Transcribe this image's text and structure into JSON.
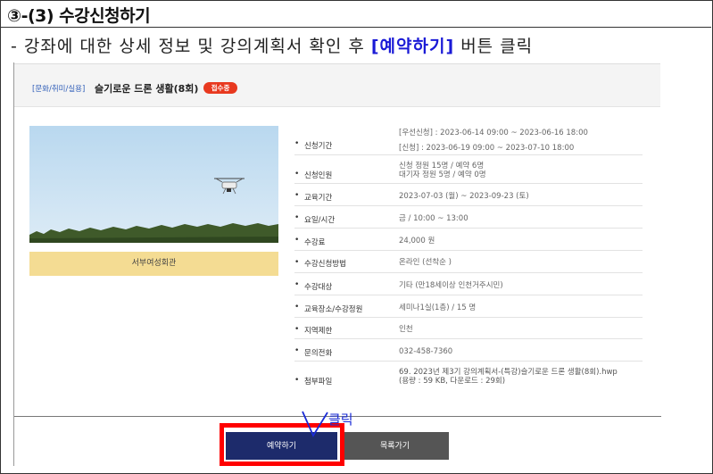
{
  "doc": {
    "step_title": "③-(3) 수강신청하기",
    "instruction_prefix": "- 강좌에 대한 상세 정보 및 강의계획서 확인 후 ",
    "instruction_highlight": "[예약하기]",
    "instruction_suffix": " 버튼 클릭",
    "click_note": "클릭"
  },
  "course": {
    "category": "[문화/취미/실용]",
    "name": "슬기로운 드론 생활(8회)",
    "status_badge": "접수중",
    "location": "서부여성회관"
  },
  "info": [
    {
      "label": "신청기간",
      "value": "[우선신청] : 2023-06-14 09:00 ~ 2023-06-16 18:00\n[신청] : 2023-06-19 09:00 ~ 2023-07-10 18:00"
    },
    {
      "label": "신청인원",
      "value": "신청 정원 15명 / 예약 6명\n대기자 정원 5명 / 예약 0명"
    },
    {
      "label": "교육기간",
      "value": "2023-07-03 (월) ~ 2023-09-23 (토)"
    },
    {
      "label": "요일/시간",
      "value": "금 / 10:00 ~ 13:00"
    },
    {
      "label": "수강료",
      "value": "24,000 원"
    },
    {
      "label": "수강신청방법",
      "value": "온라인 (선착순 )"
    },
    {
      "label": "수강대상",
      "value": "기타 (만18세이상 인천거주시민)"
    },
    {
      "label": "교육장소/수강정원",
      "value": "세미나1실(1층) / 15 명"
    },
    {
      "label": "지역제한",
      "value": "인천"
    },
    {
      "label": "문의전화",
      "value": "032-458-7360"
    },
    {
      "label": "첨부파일",
      "value": "69. 2023년 제3기 강의계획서-(특강)슬기로운 드론 생활(8회).hwp\n(용량 : 59 KB, 다운로드 : 29회)"
    }
  ],
  "buttons": {
    "reserve": "예약하기",
    "list": "목록가기"
  },
  "colors": {
    "accent_highlight": "#1a1ad6",
    "badge": "#e8391f",
    "reserve_button": "#1d2b6b",
    "list_button": "#555555",
    "location_bar": "#f4dc93",
    "callout_box": "#ff0000"
  }
}
